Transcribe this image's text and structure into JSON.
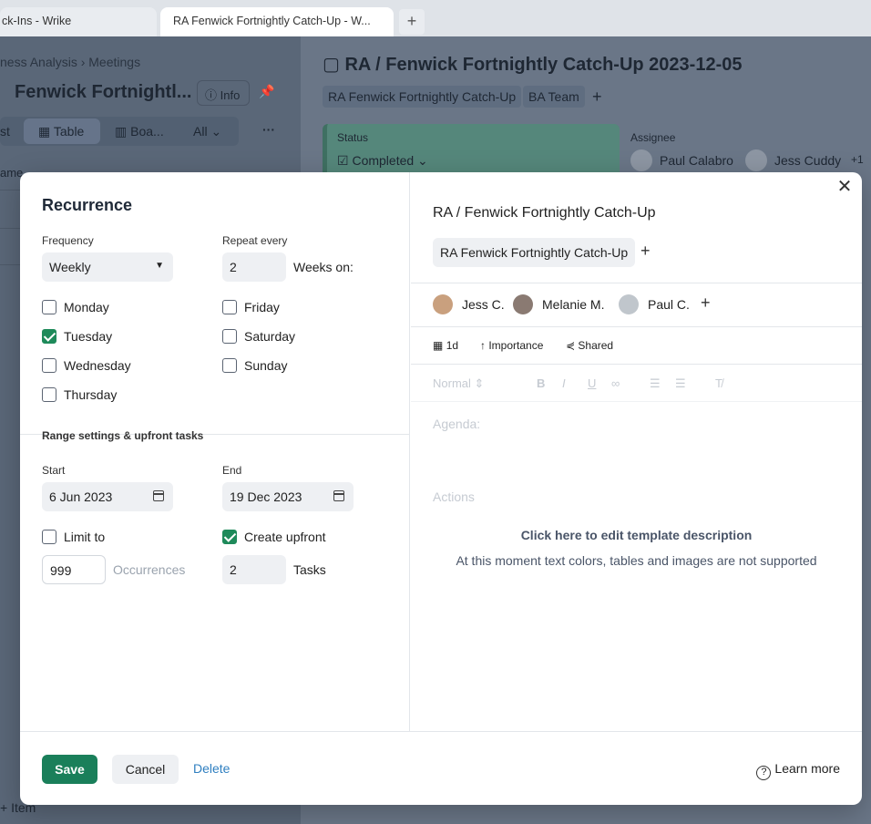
{
  "browser": {
    "tabs": [
      {
        "label": "ck-Ins - Wrike"
      },
      {
        "label": "RA Fenwick Fortnightly Catch-Up - W..."
      }
    ],
    "new_tab_symbol": "+"
  },
  "background": {
    "breadcrumb": "ness Analysis  ›  Meetings",
    "project_title": "Fenwick Fortnightl...",
    "info_label": "Info",
    "views": {
      "list": "st",
      "table": "Table",
      "board": "Boa...",
      "all": "All",
      "more": "···"
    },
    "column_header": "ame",
    "add_item": "+  Item",
    "task_title": "RA / Fenwick Fortnightly Catch-Up 2023-12-05",
    "tags": [
      "RA Fenwick Fortnightly Catch-Up",
      "BA Team"
    ],
    "status_label": "Status",
    "status_value": "Completed",
    "assignee_label": "Assignee",
    "assignees": [
      "Paul Calabro",
      "Jess Cuddy",
      "+1"
    ]
  },
  "recurrence": {
    "title": "Recurrence",
    "frequency_label": "Frequency",
    "frequency_value": "Weekly",
    "repeat_label": "Repeat every",
    "repeat_value": "2",
    "weeks_on_label": "Weeks on:",
    "days": [
      {
        "label": "Monday",
        "checked": false
      },
      {
        "label": "Tuesday",
        "checked": true
      },
      {
        "label": "Wednesday",
        "checked": false
      },
      {
        "label": "Thursday",
        "checked": false
      },
      {
        "label": "Friday",
        "checked": false
      },
      {
        "label": "Saturday",
        "checked": false
      },
      {
        "label": "Sunday",
        "checked": false
      }
    ],
    "range_title": "Range settings & upfront tasks",
    "start_label": "Start",
    "start_value": "6 Jun 2023",
    "end_label": "End",
    "end_value": "19 Dec 2023",
    "limit_label": "Limit to",
    "limit_checked": false,
    "occurrences_value": "999",
    "occurrences_label": "Occurrences",
    "upfront_label": "Create upfront",
    "upfront_checked": true,
    "tasks_value": "2",
    "tasks_label": "Tasks"
  },
  "template": {
    "task_name": "RA / Fenwick Fortnightly Catch-Up",
    "folder_chip": "RA Fenwick Fortnightly Catch-Up",
    "assignees": [
      "Jess C.",
      "Melanie M.",
      "Paul C."
    ],
    "duration": "1d",
    "importance": "Importance",
    "shared": "Shared",
    "format_style": "Normal",
    "agenda_placeholder": "Agenda:",
    "actions_placeholder": "Actions",
    "edit_hint": "Click here to edit template description",
    "unsupported_note": "At this moment text colors, tables and images are not supported"
  },
  "footer": {
    "save": "Save",
    "cancel": "Cancel",
    "delete": "Delete",
    "learn_more": "Learn more"
  },
  "colors": {
    "primary": "#1a7f5a",
    "checkbox_checked": "#1e8a5a",
    "link": "#2f7fc0"
  }
}
